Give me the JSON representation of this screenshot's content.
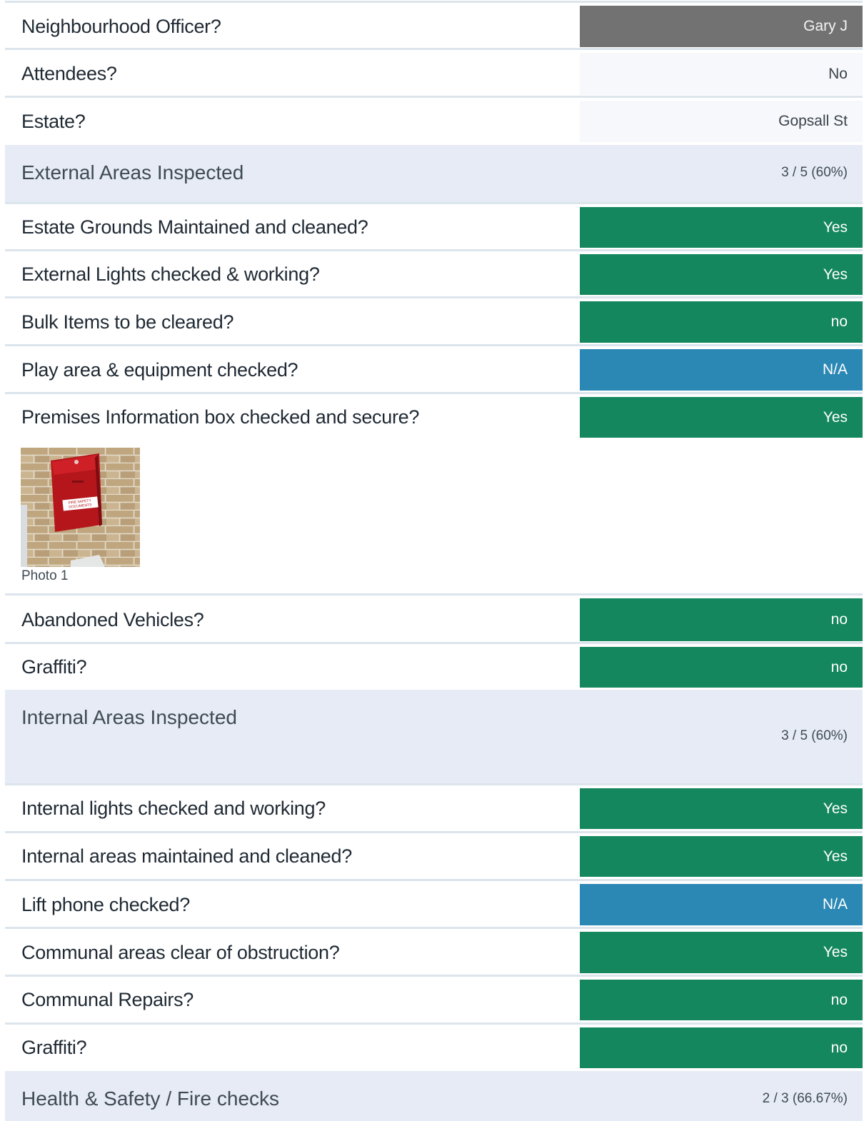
{
  "rows": {
    "r0": {
      "label": "Neighbourhood Officer?",
      "answer": "Gary J"
    },
    "r1": {
      "label": "Attendees?",
      "answer": "No"
    },
    "r2": {
      "label": "Estate?",
      "answer": "Gopsall St"
    },
    "s1": {
      "title": "External Areas Inspected",
      "score": "3 / 5 (60%)"
    },
    "r3": {
      "label": "Estate Grounds Maintained and cleaned?",
      "answer": "Yes"
    },
    "r4": {
      "label": "External Lights checked & working?",
      "answer": "Yes"
    },
    "r5": {
      "label": "Bulk Items to be cleared?",
      "answer": "no"
    },
    "r6": {
      "label": "Play area & equipment checked?",
      "answer": "N/A"
    },
    "r7": {
      "label": "Premises Information box checked and secure?",
      "answer": "Yes"
    },
    "photo": {
      "caption": "Photo 1",
      "sign_text": "FIRE SAFETY DOCUMENTS"
    },
    "r8": {
      "label": "Abandoned Vehicles?",
      "answer": "no"
    },
    "r9": {
      "label": "Graffiti?",
      "answer": "no"
    },
    "s2": {
      "title": "Internal Areas Inspected",
      "score": "3 / 5 (60%)"
    },
    "r10": {
      "label": "Internal lights checked and working?",
      "answer": "Yes"
    },
    "r11": {
      "label": "Internal areas maintained and cleaned?",
      "answer": "Yes"
    },
    "r12": {
      "label": "Lift phone checked?",
      "answer": "N/A"
    },
    "r13": {
      "label": "Communal areas clear of obstruction?",
      "answer": "Yes"
    },
    "r14": {
      "label": "Communal Repairs?",
      "answer": "no"
    },
    "r15": {
      "label": "Graffiti?",
      "answer": "no"
    },
    "s3": {
      "title": "Health & Safety / Fire checks",
      "score": "2 / 3 (66.67%)"
    }
  },
  "colors": {
    "positive": "#14875e",
    "not_applicable": "#2b88b5",
    "officer": "#727272",
    "section_background": "#e6ebf5"
  }
}
